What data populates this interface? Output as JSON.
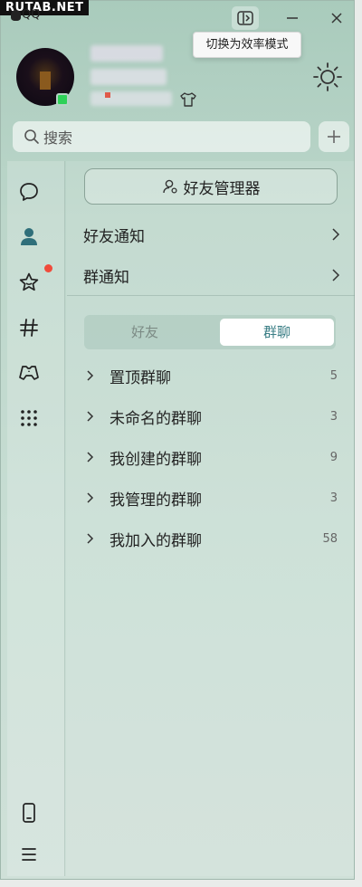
{
  "watermark": "RUTAB.NET",
  "app": {
    "logo_text": "QQ"
  },
  "window_controls": {
    "efficiency_tooltip": "切换为效率模式"
  },
  "search": {
    "placeholder": "搜索"
  },
  "contacts": {
    "friend_manager_label": "好友管理器",
    "friend_notice_label": "好友通知",
    "group_notice_label": "群通知",
    "tabs": [
      {
        "label": "好友",
        "selected": false
      },
      {
        "label": "群聊",
        "selected": true
      }
    ],
    "groups": [
      {
        "label": "置顶群聊",
        "count": "5"
      },
      {
        "label": "未命名的群聊",
        "count": "3"
      },
      {
        "label": "我创建的群聊",
        "count": "9"
      },
      {
        "label": "我管理的群聊",
        "count": "3"
      },
      {
        "label": "我加入的群聊",
        "count": "58"
      }
    ]
  },
  "sidebar": {
    "items": [
      {
        "icon": "chat-bubble-icon"
      },
      {
        "icon": "contacts-person-icon",
        "active": true
      },
      {
        "icon": "star-space-icon",
        "badge": true
      },
      {
        "icon": "hashtag-channel-icon"
      },
      {
        "icon": "game-controller-icon"
      },
      {
        "icon": "apps-grid-icon"
      },
      {
        "icon": "phone-icon"
      },
      {
        "icon": "menu-icon"
      }
    ]
  },
  "colors": {
    "accent": "#3a7e85",
    "badge": "#f04b3b",
    "online": "#2ed158"
  }
}
